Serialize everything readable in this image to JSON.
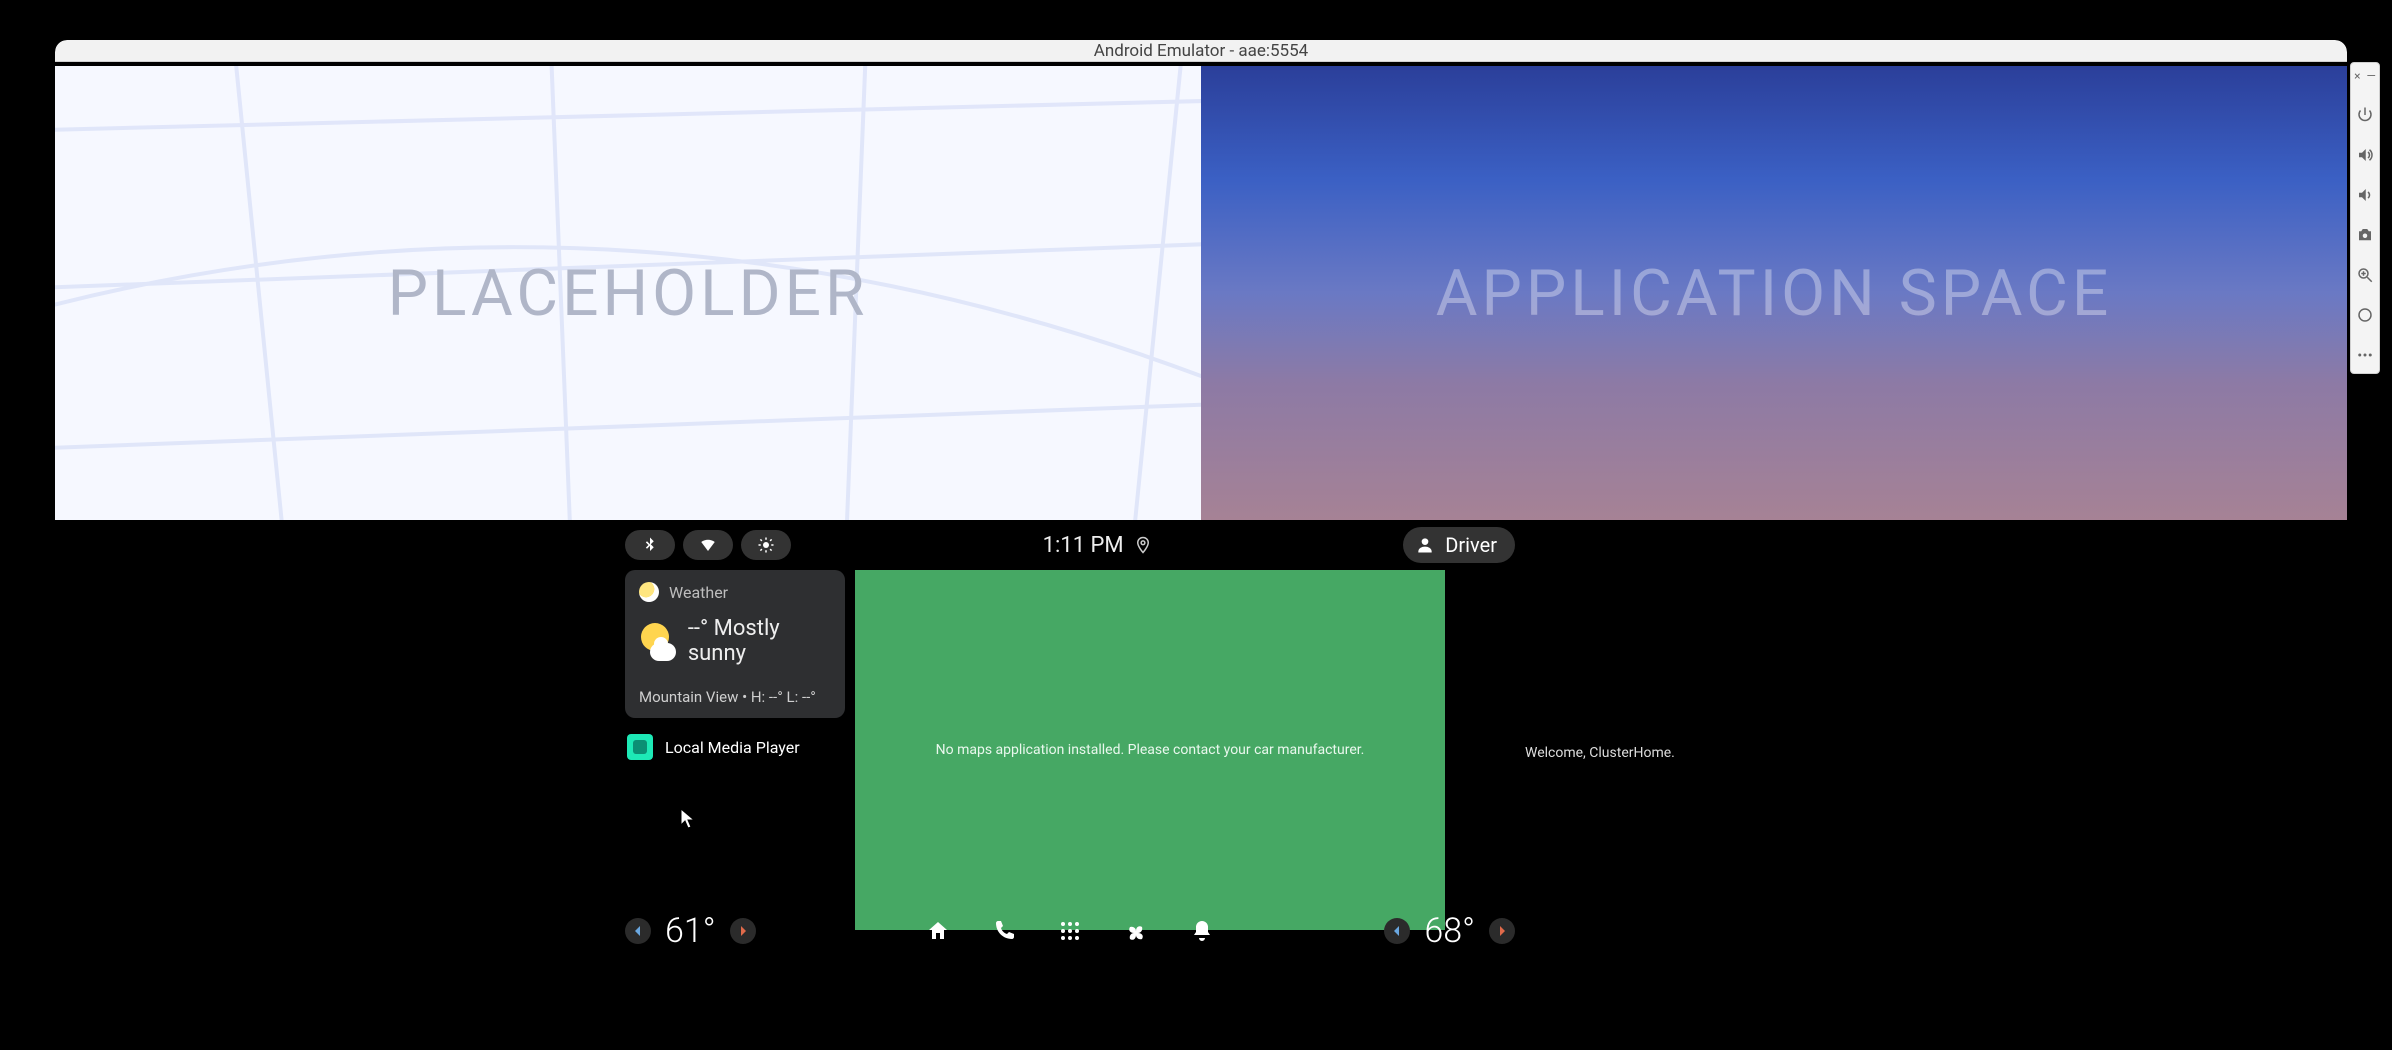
{
  "window": {
    "title": "Android Emulator - aae:5554"
  },
  "top_panes": {
    "left_label": "PLACEHOLDER",
    "right_label": "APPLICATION SPACE"
  },
  "statusbar": {
    "clock": "1:11 PM",
    "user_label": "Driver"
  },
  "weather_card": {
    "header": "Weather",
    "temp_line": "--° Mostly sunny",
    "sub_line": "Mountain View • H: --° L: --°"
  },
  "media_card": {
    "title": "Local Media Player"
  },
  "maps_panel": {
    "message": "No maps application installed. Please contact your car manufacturer."
  },
  "cluster": {
    "welcome": "Welcome, ClusterHome."
  },
  "navbar": {
    "temp_left": "61°",
    "temp_right": "68°"
  },
  "emu_toolbar": {
    "items": [
      "close",
      "minimize",
      "power",
      "volume-up",
      "volume-down",
      "camera",
      "zoom-in",
      "back",
      "more"
    ]
  }
}
